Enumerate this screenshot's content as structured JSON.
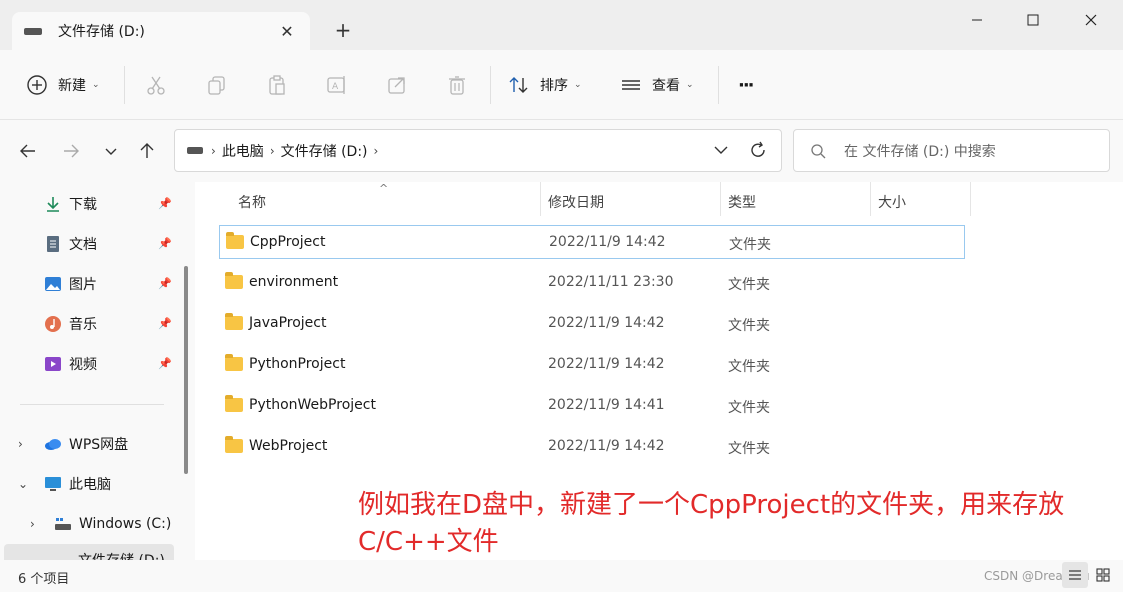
{
  "window": {
    "tab_title": "文件存储 (D:)",
    "new_tab_symbol": "+",
    "tab_close_symbol": "✕"
  },
  "toolbar": {
    "new_label": "新建",
    "sort_label": "排序",
    "view_label": "查看",
    "more_label": "···"
  },
  "address": {
    "crumbs": [
      "此电脑",
      "文件存储 (D:)"
    ]
  },
  "search": {
    "placeholder": "在 文件存储 (D:) 中搜索"
  },
  "sidebar": {
    "quick_access": [
      {
        "label": "下载",
        "icon": "download-icon",
        "color": "#1e8a5a"
      },
      {
        "label": "文档",
        "icon": "document-icon",
        "color": "#5a6d80"
      },
      {
        "label": "图片",
        "icon": "pictures-icon",
        "color": "#2f7fd6"
      },
      {
        "label": "音乐",
        "icon": "music-icon",
        "color": "#e3704e"
      },
      {
        "label": "视频",
        "icon": "video-icon",
        "color": "#8a46c9"
      }
    ],
    "tree": [
      {
        "label": "WPS网盘",
        "icon": "cloud-icon"
      },
      {
        "label": "此电脑",
        "icon": "computer-icon"
      },
      {
        "label": "Windows (C:)",
        "icon": "drive-c-icon"
      },
      {
        "label": "文件存储 (D:)",
        "icon": "drive-d-icon"
      }
    ]
  },
  "columns": {
    "name": "名称",
    "date": "修改日期",
    "type": "类型",
    "size": "大小"
  },
  "files": [
    {
      "name": "CppProject",
      "date": "2022/11/9 14:42",
      "type": "文件夹"
    },
    {
      "name": "environment",
      "date": "2022/11/11 23:30",
      "type": "文件夹"
    },
    {
      "name": "JavaProject",
      "date": "2022/11/9 14:42",
      "type": "文件夹"
    },
    {
      "name": "PythonProject",
      "date": "2022/11/9 14:42",
      "type": "文件夹"
    },
    {
      "name": "PythonWebProject",
      "date": "2022/11/9 14:41",
      "type": "文件夹"
    },
    {
      "name": "WebProject",
      "date": "2022/11/9 14:42",
      "type": "文件夹"
    }
  ],
  "status": {
    "count": "6 个项目",
    "watermark": "CSDN @DreamSu"
  },
  "annotation": "例如我在D盘中，新建了一个CppProject的文件夹，用来存放C/C++文件",
  "colors": {
    "annotation": "#e22a2a",
    "folder": "#f8c544",
    "selection_border": "#99c9ef"
  }
}
